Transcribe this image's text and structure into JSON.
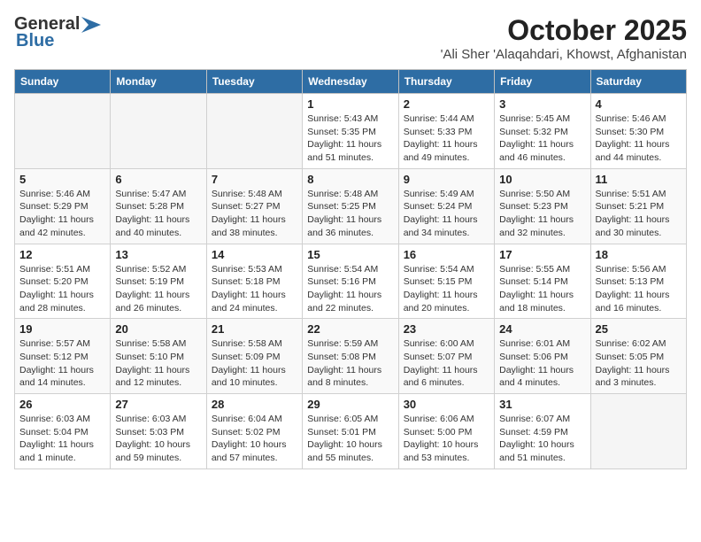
{
  "header": {
    "logo_general": "General",
    "logo_blue": "Blue",
    "title": "October 2025",
    "subtitle": "'Ali Sher 'Alaqahdari, Khowst, Afghanistan"
  },
  "weekdays": [
    "Sunday",
    "Monday",
    "Tuesday",
    "Wednesday",
    "Thursday",
    "Friday",
    "Saturday"
  ],
  "weeks": [
    [
      {
        "day": "",
        "sunrise": "",
        "sunset": "",
        "daylight": ""
      },
      {
        "day": "",
        "sunrise": "",
        "sunset": "",
        "daylight": ""
      },
      {
        "day": "",
        "sunrise": "",
        "sunset": "",
        "daylight": ""
      },
      {
        "day": "1",
        "sunrise": "Sunrise: 5:43 AM",
        "sunset": "Sunset: 5:35 PM",
        "daylight": "Daylight: 11 hours and 51 minutes."
      },
      {
        "day": "2",
        "sunrise": "Sunrise: 5:44 AM",
        "sunset": "Sunset: 5:33 PM",
        "daylight": "Daylight: 11 hours and 49 minutes."
      },
      {
        "day": "3",
        "sunrise": "Sunrise: 5:45 AM",
        "sunset": "Sunset: 5:32 PM",
        "daylight": "Daylight: 11 hours and 46 minutes."
      },
      {
        "day": "4",
        "sunrise": "Sunrise: 5:46 AM",
        "sunset": "Sunset: 5:30 PM",
        "daylight": "Daylight: 11 hours and 44 minutes."
      }
    ],
    [
      {
        "day": "5",
        "sunrise": "Sunrise: 5:46 AM",
        "sunset": "Sunset: 5:29 PM",
        "daylight": "Daylight: 11 hours and 42 minutes."
      },
      {
        "day": "6",
        "sunrise": "Sunrise: 5:47 AM",
        "sunset": "Sunset: 5:28 PM",
        "daylight": "Daylight: 11 hours and 40 minutes."
      },
      {
        "day": "7",
        "sunrise": "Sunrise: 5:48 AM",
        "sunset": "Sunset: 5:27 PM",
        "daylight": "Daylight: 11 hours and 38 minutes."
      },
      {
        "day": "8",
        "sunrise": "Sunrise: 5:48 AM",
        "sunset": "Sunset: 5:25 PM",
        "daylight": "Daylight: 11 hours and 36 minutes."
      },
      {
        "day": "9",
        "sunrise": "Sunrise: 5:49 AM",
        "sunset": "Sunset: 5:24 PM",
        "daylight": "Daylight: 11 hours and 34 minutes."
      },
      {
        "day": "10",
        "sunrise": "Sunrise: 5:50 AM",
        "sunset": "Sunset: 5:23 PM",
        "daylight": "Daylight: 11 hours and 32 minutes."
      },
      {
        "day": "11",
        "sunrise": "Sunrise: 5:51 AM",
        "sunset": "Sunset: 5:21 PM",
        "daylight": "Daylight: 11 hours and 30 minutes."
      }
    ],
    [
      {
        "day": "12",
        "sunrise": "Sunrise: 5:51 AM",
        "sunset": "Sunset: 5:20 PM",
        "daylight": "Daylight: 11 hours and 28 minutes."
      },
      {
        "day": "13",
        "sunrise": "Sunrise: 5:52 AM",
        "sunset": "Sunset: 5:19 PM",
        "daylight": "Daylight: 11 hours and 26 minutes."
      },
      {
        "day": "14",
        "sunrise": "Sunrise: 5:53 AM",
        "sunset": "Sunset: 5:18 PM",
        "daylight": "Daylight: 11 hours and 24 minutes."
      },
      {
        "day": "15",
        "sunrise": "Sunrise: 5:54 AM",
        "sunset": "Sunset: 5:16 PM",
        "daylight": "Daylight: 11 hours and 22 minutes."
      },
      {
        "day": "16",
        "sunrise": "Sunrise: 5:54 AM",
        "sunset": "Sunset: 5:15 PM",
        "daylight": "Daylight: 11 hours and 20 minutes."
      },
      {
        "day": "17",
        "sunrise": "Sunrise: 5:55 AM",
        "sunset": "Sunset: 5:14 PM",
        "daylight": "Daylight: 11 hours and 18 minutes."
      },
      {
        "day": "18",
        "sunrise": "Sunrise: 5:56 AM",
        "sunset": "Sunset: 5:13 PM",
        "daylight": "Daylight: 11 hours and 16 minutes."
      }
    ],
    [
      {
        "day": "19",
        "sunrise": "Sunrise: 5:57 AM",
        "sunset": "Sunset: 5:12 PM",
        "daylight": "Daylight: 11 hours and 14 minutes."
      },
      {
        "day": "20",
        "sunrise": "Sunrise: 5:58 AM",
        "sunset": "Sunset: 5:10 PM",
        "daylight": "Daylight: 11 hours and 12 minutes."
      },
      {
        "day": "21",
        "sunrise": "Sunrise: 5:58 AM",
        "sunset": "Sunset: 5:09 PM",
        "daylight": "Daylight: 11 hours and 10 minutes."
      },
      {
        "day": "22",
        "sunrise": "Sunrise: 5:59 AM",
        "sunset": "Sunset: 5:08 PM",
        "daylight": "Daylight: 11 hours and 8 minutes."
      },
      {
        "day": "23",
        "sunrise": "Sunrise: 6:00 AM",
        "sunset": "Sunset: 5:07 PM",
        "daylight": "Daylight: 11 hours and 6 minutes."
      },
      {
        "day": "24",
        "sunrise": "Sunrise: 6:01 AM",
        "sunset": "Sunset: 5:06 PM",
        "daylight": "Daylight: 11 hours and 4 minutes."
      },
      {
        "day": "25",
        "sunrise": "Sunrise: 6:02 AM",
        "sunset": "Sunset: 5:05 PM",
        "daylight": "Daylight: 11 hours and 3 minutes."
      }
    ],
    [
      {
        "day": "26",
        "sunrise": "Sunrise: 6:03 AM",
        "sunset": "Sunset: 5:04 PM",
        "daylight": "Daylight: 11 hours and 1 minute."
      },
      {
        "day": "27",
        "sunrise": "Sunrise: 6:03 AM",
        "sunset": "Sunset: 5:03 PM",
        "daylight": "Daylight: 10 hours and 59 minutes."
      },
      {
        "day": "28",
        "sunrise": "Sunrise: 6:04 AM",
        "sunset": "Sunset: 5:02 PM",
        "daylight": "Daylight: 10 hours and 57 minutes."
      },
      {
        "day": "29",
        "sunrise": "Sunrise: 6:05 AM",
        "sunset": "Sunset: 5:01 PM",
        "daylight": "Daylight: 10 hours and 55 minutes."
      },
      {
        "day": "30",
        "sunrise": "Sunrise: 6:06 AM",
        "sunset": "Sunset: 5:00 PM",
        "daylight": "Daylight: 10 hours and 53 minutes."
      },
      {
        "day": "31",
        "sunrise": "Sunrise: 6:07 AM",
        "sunset": "Sunset: 4:59 PM",
        "daylight": "Daylight: 10 hours and 51 minutes."
      },
      {
        "day": "",
        "sunrise": "",
        "sunset": "",
        "daylight": ""
      }
    ]
  ]
}
